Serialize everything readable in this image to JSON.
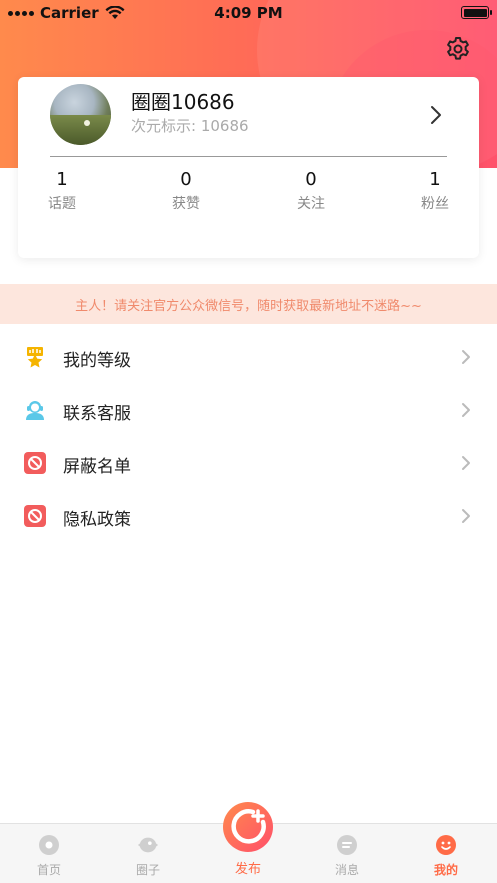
{
  "status_bar": {
    "carrier": "Carrier",
    "time": "4:09 PM"
  },
  "profile": {
    "name": "圈圈10686",
    "id_text": "次元标示: 10686",
    "stats": [
      {
        "value": "1",
        "label": "话题"
      },
      {
        "value": "0",
        "label": "获赞"
      },
      {
        "value": "0",
        "label": "关注"
      },
      {
        "value": "1",
        "label": "粉丝"
      }
    ]
  },
  "notice": "主人！请关注官方公众微信号，随时获取最新地址不迷路~~",
  "menu": [
    {
      "label": "我的等级",
      "icon": "level-crown-icon"
    },
    {
      "label": "联系客服",
      "icon": "customer-service-icon"
    },
    {
      "label": "屏蔽名单",
      "icon": "block-list-icon"
    },
    {
      "label": "隐私政策",
      "icon": "privacy-policy-icon"
    }
  ],
  "tabbar": {
    "home": "首页",
    "circle": "圈子",
    "publish": "发布",
    "messages": "消息",
    "mine": "我的"
  },
  "colors": {
    "accent": "#ff6b47",
    "header_start": "#ff8a4c",
    "header_end": "#ff4f6a",
    "notice_bg": "#fde6dd",
    "notice_text": "#f08a6c"
  }
}
